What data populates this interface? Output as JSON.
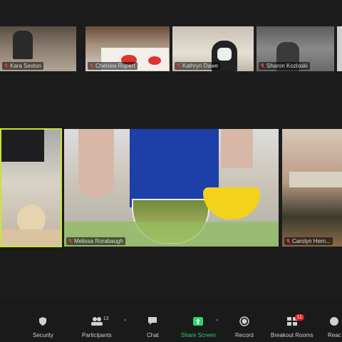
{
  "app": {
    "accent": "#2bd66a",
    "active_speaker_border": "#c8e340",
    "mute_color": "#e23b3b"
  },
  "gallery": {
    "top_row": [
      {
        "name": "Kara Sexton",
        "muted": true
      },
      {
        "name": "Chelsea Rupert",
        "muted": true
      },
      {
        "name": "Kathryn Dawe",
        "muted": true
      },
      {
        "name": "Sharon Kozloski",
        "muted": true
      }
    ],
    "middle_row": [
      {
        "name": "",
        "muted": false,
        "active_speaker": true
      },
      {
        "name": "Melissa Rorabaugh",
        "muted": true
      },
      {
        "name": "Carolyn Hern...",
        "muted": true
      }
    ]
  },
  "toolbar": {
    "security_label": "Security",
    "participants_label": "Participants",
    "participants_count": "13",
    "chat_label": "Chat",
    "share_label": "Share Screen",
    "record_label": "Record",
    "breakout_label": "Breakout Rooms",
    "breakout_badge": "11",
    "reactions_label": "Reac",
    "icons": [
      "shield-icon",
      "participants-icon",
      "chat-icon",
      "share-screen-icon",
      "record-icon",
      "breakout-rooms-icon",
      "reactions-icon"
    ]
  }
}
